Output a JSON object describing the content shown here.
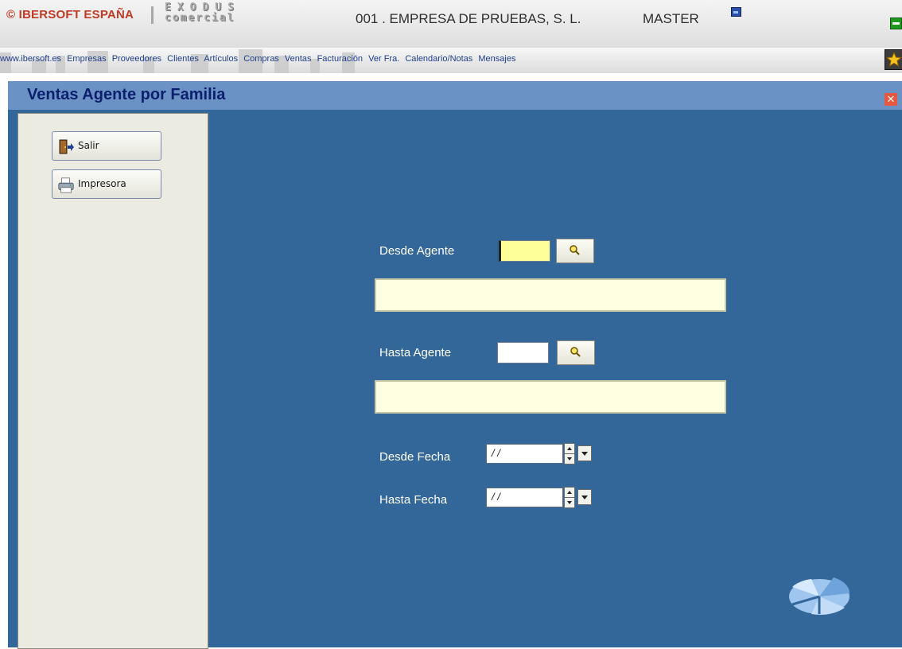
{
  "header": {
    "brand": "© IBERSOFT ESPAÑA",
    "product_line1": "EXODUS",
    "product_line2": "comercial",
    "company": "001 . EMPRESA DE PRUEBAS, S. L.",
    "user": "MASTER"
  },
  "menu": {
    "items": [
      "www.ibersoft.es",
      "Empresas",
      "Proveedores",
      "Clientes",
      "Artículos",
      "Compras",
      "Ventas",
      "Facturación",
      "Ver Fra.",
      "Calendario/Notas",
      "Mensajes"
    ]
  },
  "window": {
    "title": "Ventas Agente por Familia",
    "close_icon": "close-icon"
  },
  "sidebar": {
    "buttons": [
      {
        "label": "Salir",
        "icon": "exit-door-icon"
      },
      {
        "label": "Impresora",
        "icon": "printer-icon"
      }
    ]
  },
  "form": {
    "desde_agente": {
      "label": "Desde Agente",
      "code": "",
      "name": ""
    },
    "hasta_agente": {
      "label": "Hasta Agente",
      "code": "",
      "name": ""
    },
    "desde_fecha": {
      "label": "Desde Fecha",
      "value": " / /"
    },
    "hasta_fecha": {
      "label": "Hasta Fecha",
      "value": " / /"
    }
  },
  "colors": {
    "accent_title": "#0b1f6e",
    "body_bg": "#336699",
    "title_bar": "#6b92c4",
    "brand_red": "#c23a24",
    "focus_yellow": "#ffff99"
  }
}
